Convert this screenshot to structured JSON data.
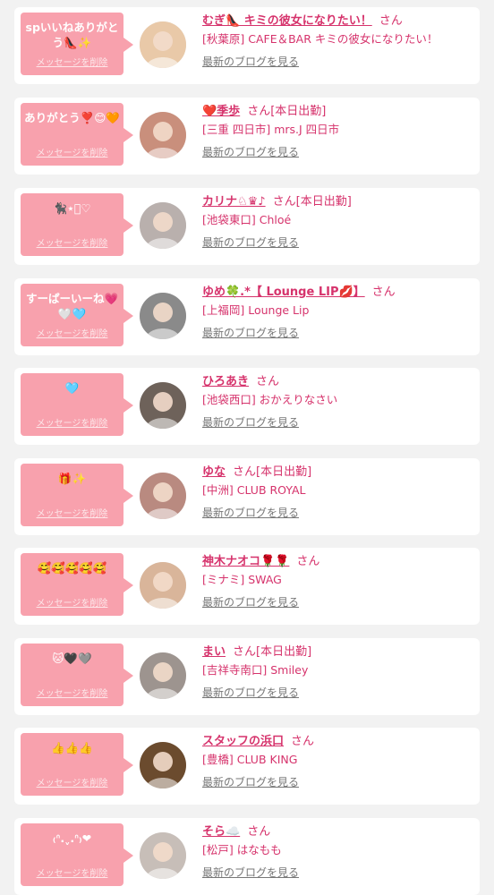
{
  "delete_label": "メッセージを削除",
  "blog_label": "最新のブログを見る",
  "san_label": "さん",
  "colors": {
    "bubble": "#f8a1ad",
    "accent": "#d6336c",
    "background": "#f2f2f2"
  },
  "items": [
    {
      "message": "spいいねありがとう👠✨",
      "name": "むぎ👠 キミの彼女になりたい！",
      "status": "",
      "shop": "[秋葉原] CAFE＆BAR キミの彼女になりたい！",
      "avatar_color": "#e9c9a8"
    },
    {
      "message": "ありがとう❣️😊🧡",
      "name": "❤️季歩",
      "status": "[本日出勤]",
      "shop": "[三重 四日市] mrs.J 四日市",
      "avatar_color": "#c98f7c"
    },
    {
      "message": "🐈‍⬛⋆͛♡",
      "name": "カリナ♘♛♪",
      "status": "[本日出勤]",
      "shop": "[池袋東口] Chloé",
      "avatar_color": "#b9b0ad"
    },
    {
      "message": "すーぱーいーね💗🤍🩵",
      "name": "ゆめ🍀.*【 Lounge LIP💋】",
      "status": "",
      "shop": "[上福岡] Lounge Lip",
      "avatar_color": "#8a8a8a"
    },
    {
      "message": "🩵",
      "name": "ひろあき",
      "status": "",
      "shop": "[池袋西口] おかえりなさい",
      "avatar_color": "#6e625a"
    },
    {
      "message": "🎁✨",
      "name": "ゆな",
      "status": "[本日出勤]",
      "shop": "[中洲] CLUB ROYAL",
      "avatar_color": "#b98a80"
    },
    {
      "message": "🥰🥰🥰🥰🥰",
      "name": "神木ナオコ🌹🌹",
      "status": "",
      "shop": "[ミナミ] SWAG",
      "avatar_color": "#d9b59a"
    },
    {
      "message": "🐱🖤🩶",
      "name": "まい",
      "status": "[本日出勤]",
      "shop": "[吉祥寺南口] Smiley",
      "avatar_color": "#9d948f"
    },
    {
      "message": "👍👍👍",
      "name": "スタッフの浜口",
      "status": "",
      "shop": "[豊橋] CLUB KING",
      "avatar_color": "#6b4b2e"
    },
    {
      "message": "₍ᐢ.ˬ.ᐢ₎❤",
      "name": "そら☁️",
      "status": "",
      "shop": "[松戸] はなもも",
      "avatar_color": "#c7beb8"
    }
  ]
}
